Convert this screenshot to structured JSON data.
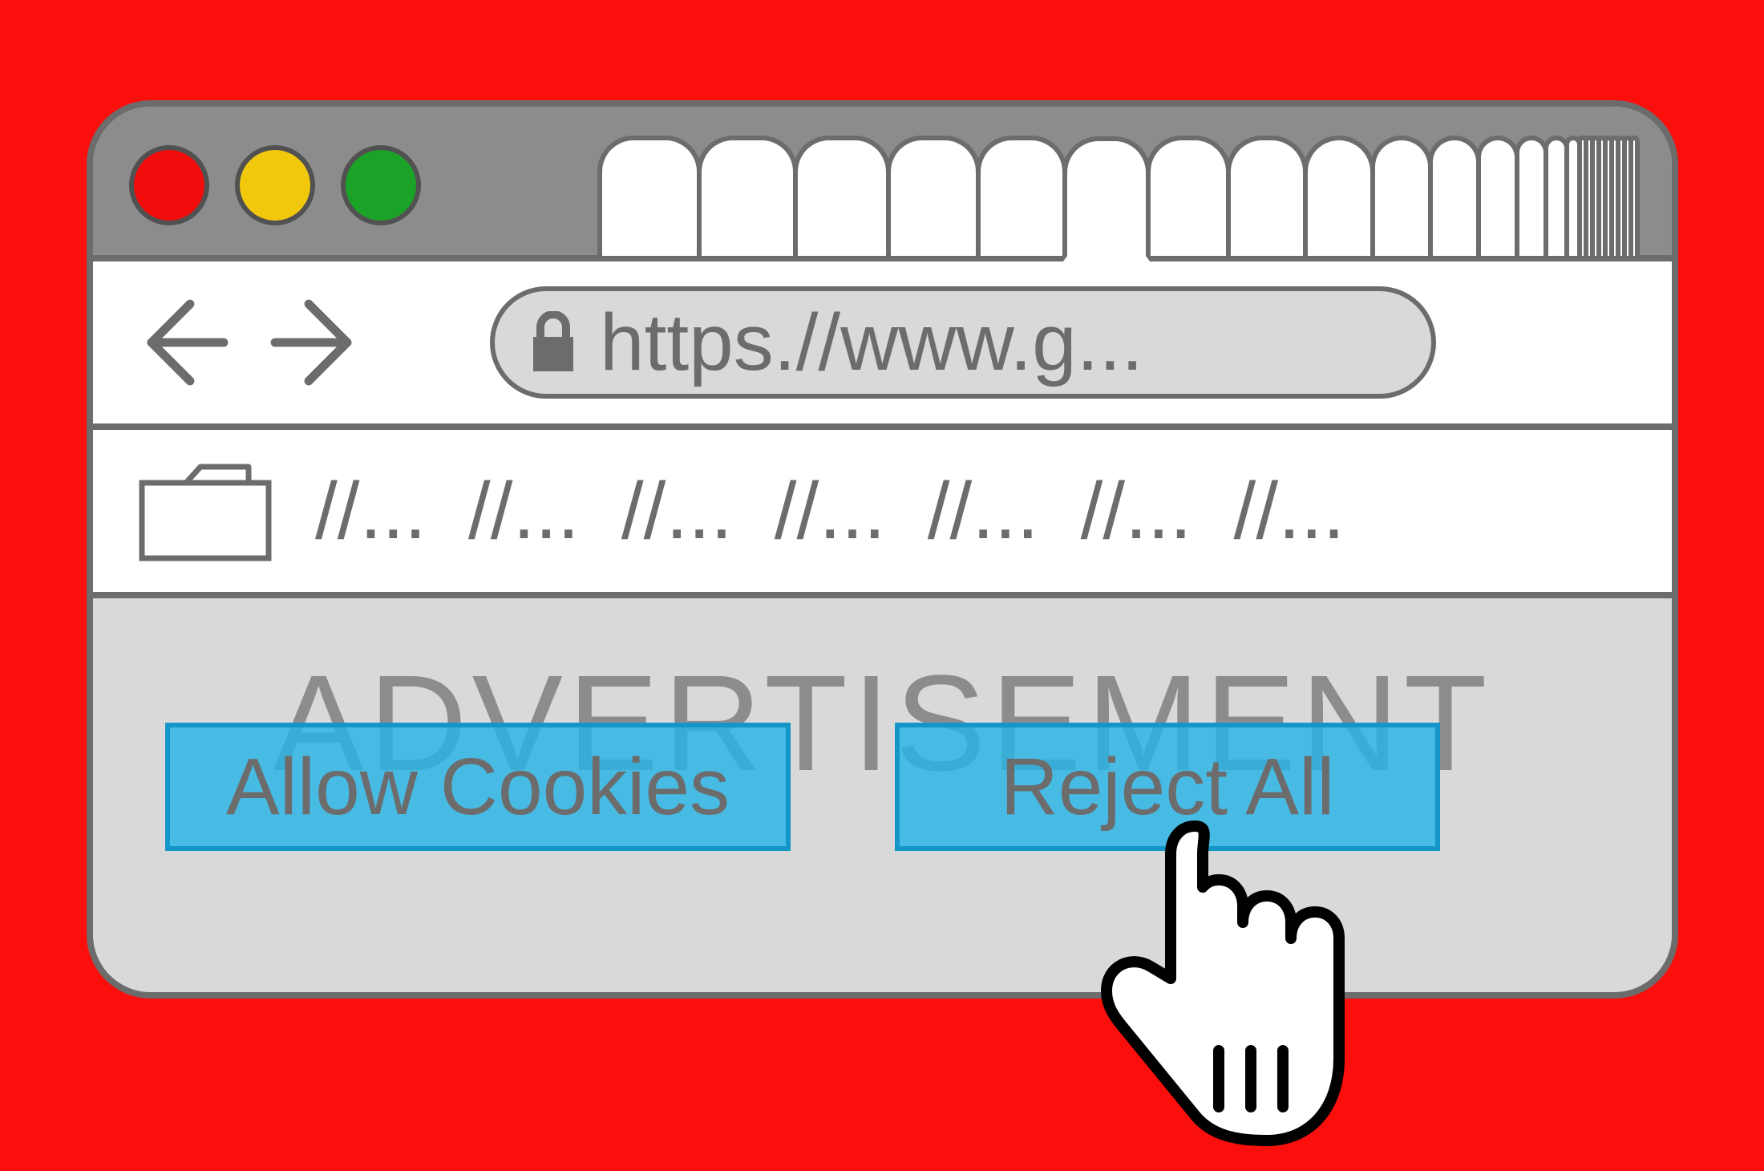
{
  "window": {
    "traffic": {
      "close": "red",
      "minimize": "yellow",
      "zoom": "green"
    },
    "tabs": {
      "count": 24,
      "active_index": 5
    }
  },
  "toolbar": {
    "back": "←",
    "forward": "→",
    "url": "https.//www.g..."
  },
  "bookmarks": {
    "items": [
      "//...",
      "//...",
      "//...",
      "//...",
      "//...",
      "//...",
      "//..."
    ]
  },
  "content": {
    "ad_label": "ADVERTISEMENT"
  },
  "cookies": {
    "allow_label": "Allow Cookies",
    "reject_label": "Reject All"
  }
}
